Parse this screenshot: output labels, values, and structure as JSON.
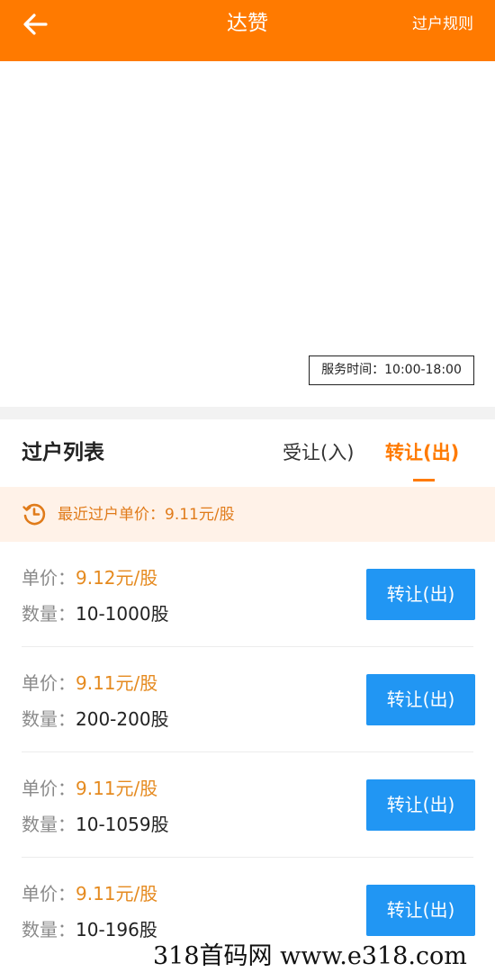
{
  "header": {
    "back_icon": "arrow-left-icon",
    "title": "达赞",
    "rules_link": "过户规则",
    "color": "#ff7a00"
  },
  "banner": {
    "service_hours": "服务时间：10:00-18:00"
  },
  "list": {
    "title": "过户列表",
    "tabs": [
      {
        "label": "受让(入)",
        "active": false
      },
      {
        "label": "转让(出)",
        "active": true
      }
    ],
    "recent_icon": "clock-history-icon",
    "recent_price": "最近过户单价：9.11元/股",
    "price_label": "单价：",
    "qty_label": "数量：",
    "items": [
      {
        "price": "9.12元/股",
        "qty": "10-1000股",
        "button": "转让(出)"
      },
      {
        "price": "9.11元/股",
        "qty": "200-200股",
        "button": "转让(出)"
      },
      {
        "price": "9.11元/股",
        "qty": "10-1059股",
        "button": "转让(出)"
      },
      {
        "price": "9.11元/股",
        "qty": "10-196股",
        "button": "转让(出)"
      }
    ]
  },
  "watermark": {
    "text": "318首码网  www.e318.com"
  },
  "colors": {
    "accent": "#ff7a00",
    "price": "#e58a1f",
    "button": "#2196f3",
    "recent_bg": "#fff2e8"
  }
}
